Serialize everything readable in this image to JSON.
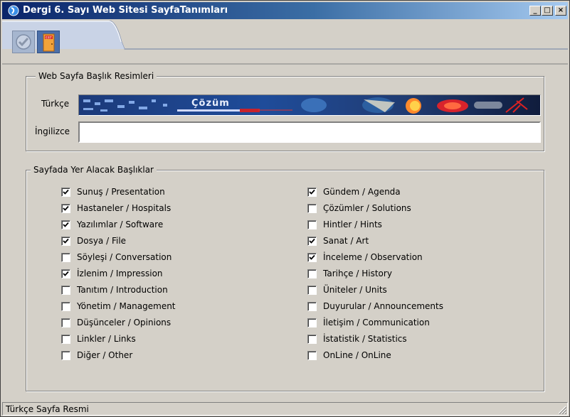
{
  "window": {
    "title": "Dergi 6. Sayı Web Sitesi SayfaTanımları",
    "minimize": "_",
    "maximize": "□",
    "close": "×"
  },
  "toolbar": {
    "ok_icon": "check-icon",
    "exit_icon": "exit-door-icon",
    "exit_sign": "EXIT"
  },
  "header_group": {
    "legend": "Web Sayfa Başlık Resimleri",
    "turkish_label": "Türkçe",
    "english_label": "İngilizce",
    "english_value": "",
    "banner_text": "Çözüm"
  },
  "topics_group": {
    "legend": "Sayfada Yer Alacak Başlıklar",
    "left": [
      {
        "label": "Sunuş / Presentation",
        "checked": true
      },
      {
        "label": "Hastaneler / Hospitals",
        "checked": true
      },
      {
        "label": "Yazılımlar / Software",
        "checked": true
      },
      {
        "label": "Dosya / File",
        "checked": true
      },
      {
        "label": "Söyleşi / Conversation",
        "checked": false
      },
      {
        "label": "İzlenim / Impression",
        "checked": true
      },
      {
        "label": "Tanıtım / Introduction",
        "checked": false
      },
      {
        "label": "Yönetim / Management",
        "checked": false
      },
      {
        "label": "Düşünceler / Opinions",
        "checked": false
      },
      {
        "label": "Linkler / Links",
        "checked": false
      },
      {
        "label": "Diğer / Other",
        "checked": false
      }
    ],
    "right": [
      {
        "label": "Gündem / Agenda",
        "checked": true
      },
      {
        "label": "Çözümler / Solutions",
        "checked": false
      },
      {
        "label": "Hintler / Hints",
        "checked": false
      },
      {
        "label": "Sanat / Art",
        "checked": true
      },
      {
        "label": "İnceleme / Observation",
        "checked": true
      },
      {
        "label": "Tarihçe / History",
        "checked": false
      },
      {
        "label": "Üniteler / Units",
        "checked": false
      },
      {
        "label": "Duyurular / Announcements",
        "checked": false
      },
      {
        "label": "İletişim / Communication",
        "checked": false
      },
      {
        "label": "İstatistik / Statistics",
        "checked": false
      },
      {
        "label": "OnLine / OnLine",
        "checked": false
      }
    ]
  },
  "status": {
    "text": "Türkçe Sayfa Resmi"
  },
  "colors": {
    "title_bar_start": "#0a246a",
    "title_bar_end": "#a6caf0",
    "face": "#d4d0c8"
  }
}
